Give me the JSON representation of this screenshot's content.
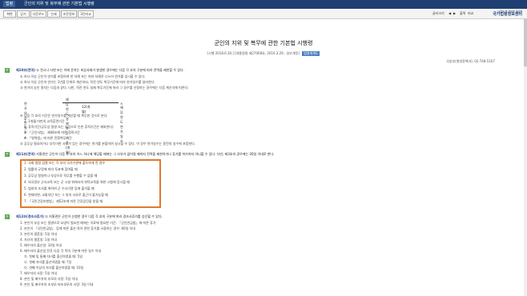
{
  "titlebar": {
    "tag": "법령",
    "title": "군인의 지위 및 복무에 관한 기본법 시행령"
  },
  "toolbar": {
    "buttons": [
      "화면",
      "닫기",
      "다운로드",
      "인쇄",
      "조문정보",
      "3단비교"
    ],
    "utils": [
      "글자크기",
      "◀",
      "▶",
      "출력",
      "비교"
    ],
    "logo_line1": "나라의 법 정보를 한곳에",
    "logo_line2": "국가법령정보센터"
  },
  "doc": {
    "title": "군인의 지위 및 복무에 관한 기본법 시행령",
    "meta": "[시행 2018.6.30.] [대통령령 제27068호, 2016.3.29., 일부개정]",
    "badge": "법령체계도",
    "agency": "국방부(병영정책과), 02-748-5167"
  },
  "art1": {
    "mark": "본",
    "heading": "제10조(전역)",
    "intro": "① 전시나 사변 또는 이에 준하는 비상사태가 발생한 경우에는 다음 각 호의 구분에 따라 전역을 제한할 수 있다.",
    "lines": [
      "① 하사 이상 군인이 연가를 포함하여 한 차례 또는 여러 차례로 나누어 연가를 실시할 수 있다.",
      "② 하사 이상 군인의 연가는 1년을 단위로 계산하되, 직전 연도 복무기간에 따라 연가일수를 달리한다.",
      "③ 연가의 승인 절차는 다음과 같다. 다만, 직전 연도 실제 복무기간에 따라 그 일수를 산정하는 경우에는 다음 계산식에 따른다.",
      "④ 다음 각 호의 기간은 연가일수를 계산할 때 복무한 것으로 본다.",
      "1. 1개월 미만의 교육훈련기간",
      "2. 휴직기간(공무상 질병 또는 부상으로 인한 휴직기간은 제외한다)",
      "3. 「군인사법」 제48조에 따른 정직기간",
      "4. 「병역법」에 따른 전환복무기간",
      "⑤ 공무상 필요하거나 부득이한 사유가 있는 경우에는 연가를 분할하여 실시할 수 있다. 이 경우 연가일수는 종전의 일수에 포함한다."
    ],
    "formula_left": "연가의 승인 일수 =",
    "formula_num": "해당 연도 실제 복무기간(개월)",
    "formula_den": "12(개월)",
    "formula_right": "× 해당 연도 연가일수"
  },
  "art2": {
    "mark": "본",
    "heading": "제11조(전역)",
    "intro": "지휘관은 군인이 다음 각 호의 어느 하나에 해당할 때에는 그 사유가 없어질 때까지 전역을 제한하거나 휴가를 허가하지 아니할 수 있다. 다만, 제3호의 경우에는 30일 이내로 한다.",
    "items": [
      "1. 국회 법령 검열 또는 각 부의 국가기관에 출두하게 된 경우",
      "2. 법률의 규정에 따라 투표에 참여할 때",
      "3. 공무상 질병이나 부상으로 직무를 수행할 수 없을 때",
      "4. 외국정부 군사교육 또는 군 시설 위에서의 위탁교육을 위한 시험에 응시할 때",
      "5. 범죄의 조사를 위하여 군 수사기관 등에 출석할 때",
      "6. 천재지변, 교통차단 또는 그 밖의 사유로 출근이 불가능할 때",
      "7. 「국민건강보험법」 제52조에 따른 건강검진을 받을 때"
    ]
  },
  "art3": {
    "mark": "본",
    "heading": "제12조(경조사휴가)",
    "intro": "① 지휘관은 군인이 신청한 경우 다음 각 호의 구분에 따라 경조사휴가를 승인할 수 있다.",
    "lines": [
      "1. 본인이 부상 또는 질병으로 요양이 필요한 때에는 치료에 필요한 기간: 「군인연금법」에 따른 휴가",
      "2. 본인이 「국민연금법」 등에 따른 출산·육아 관련 휴가를 사용하는 경우: 60일 이내",
      "3. 본인의 결혼일: 5일 이내",
      "4. 자녀의 결혼일: 1일 이내",
      "5. 배우자의 출산일: 10일 이내",
      "6. 배우자의 출산일 전후 다음 각 목의 구분에 따른 일수 이내",
      "가. 첫째 및 둘째 자녀를 출산하였을 때: 5일",
      "나. 셋째 자녀를 출산하였을 때: 7일",
      "다. 넷째 이상의 자녀를 출산하였을 때: 10일",
      "7. 배우자의 사망: 5일 이내",
      "8. 본인 및 배우자의 부모의 사망: 5일 이내",
      "9. 본인 및 배우자의 조부모·외조부모의 사망: 3일 이내"
    ]
  }
}
